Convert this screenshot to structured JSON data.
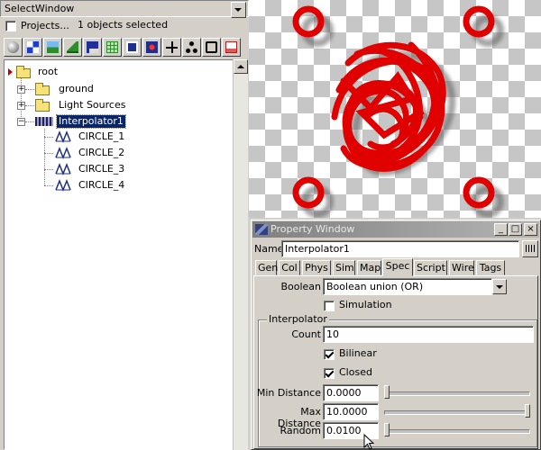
{
  "select_window": {
    "title": "SelectWindow",
    "projects_label": "Projects...",
    "projects_checked": false,
    "selection_status": "1 objects selected",
    "toolbar_icons": [
      "sphere-icon",
      "checker-icon",
      "landscape-icon",
      "terrain-icon",
      "save-icon",
      "grid-icon",
      "chart-icon",
      "light-icon",
      "tree-icon",
      "network-icon",
      "frame-icon",
      "document-icon"
    ]
  },
  "tree": {
    "root": "root",
    "ground": "ground",
    "light_sources": "Light Sources",
    "interpolator": "Interpolator1",
    "circles": [
      "CIRCLE_1",
      "CIRCLE_2",
      "CIRCLE_3",
      "CIRCLE_4"
    ]
  },
  "viewport": {
    "bg_check_light": "#ffffff",
    "bg_check_dark": "#c6c6c6",
    "object_color": "#e00000"
  },
  "property_window": {
    "title": "Property Window",
    "name_label": "Name",
    "name_value": "Interpolator1",
    "tabs": [
      "Gen",
      "Col",
      "Phys",
      "Sim",
      "Map",
      "Spec",
      "Script",
      "Wire",
      "Tags"
    ],
    "active_tab": "Spec",
    "boolean_label": "Boolean",
    "boolean_value": "Boolean union (OR)",
    "simulation_label": "Simulation",
    "simulation_checked": false,
    "interpolator_group": "Interpolator",
    "count_label": "Count",
    "count_value": "10",
    "bilinear_label": "Bilinear",
    "bilinear_checked": true,
    "closed_label": "Closed",
    "closed_checked": true,
    "min_distance_label": "Min Distance",
    "min_distance_value": "0.0000",
    "max_distance_label": "Max Distance",
    "max_distance_value": "10.0000",
    "random_label": "Random",
    "random_value": "0.0100",
    "min_slider_level": 0.0,
    "max_slider_level": 1.0,
    "random_slider_level": 0.0
  }
}
